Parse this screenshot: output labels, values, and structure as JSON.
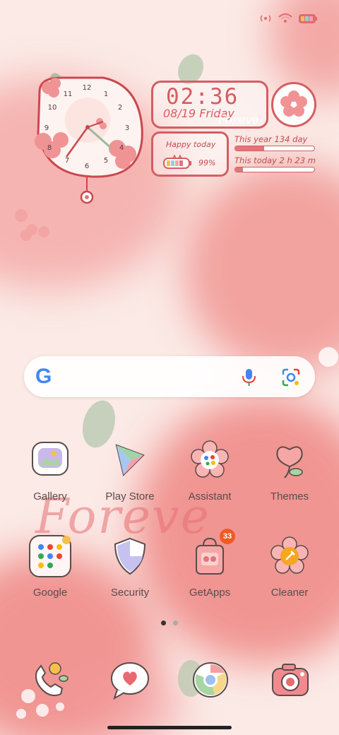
{
  "status_bar": {
    "icons": [
      "hotspot-icon",
      "wifi-icon",
      "battery-icon"
    ]
  },
  "widgets": {
    "clock_numbers": [
      "12",
      "1",
      "2",
      "3",
      "4",
      "5",
      "6",
      "7",
      "8",
      "9",
      "10",
      "11"
    ],
    "time": "02:36",
    "date": "08/19 Friday",
    "forever_small": "Foreve",
    "happy_today": "Happy today",
    "battery_percent": "99%",
    "this_year": "This year 134 day",
    "this_year_progress": 0.37,
    "this_today": "This today 2 h 23 m",
    "this_today_progress": 0.1
  },
  "search": {
    "logo": "G",
    "mic_icon": "mic-icon",
    "lens_icon": "lens-icon"
  },
  "apps_row1": [
    {
      "label": "Gallery",
      "icon": "gallery-icon"
    },
    {
      "label": "Play Store",
      "icon": "play-store-icon"
    },
    {
      "label": "Assistant",
      "icon": "assistant-icon"
    },
    {
      "label": "Themes",
      "icon": "themes-icon"
    }
  ],
  "apps_row2": [
    {
      "label": "Google",
      "icon": "google-folder-icon"
    },
    {
      "label": "Security",
      "icon": "security-icon"
    },
    {
      "label": "GetApps",
      "icon": "getapps-icon",
      "badge": "33"
    },
    {
      "label": "Cleaner",
      "icon": "cleaner-icon"
    }
  ],
  "wallpaper_text": "Foreve",
  "page_indicator": {
    "pages": 2,
    "current": 1
  },
  "dock": [
    "phone-icon",
    "messages-icon",
    "chrome-icon",
    "camera-icon"
  ],
  "colors": {
    "accent": "#d65d62",
    "background": "#fbeae6",
    "badge": "#f15a24"
  }
}
